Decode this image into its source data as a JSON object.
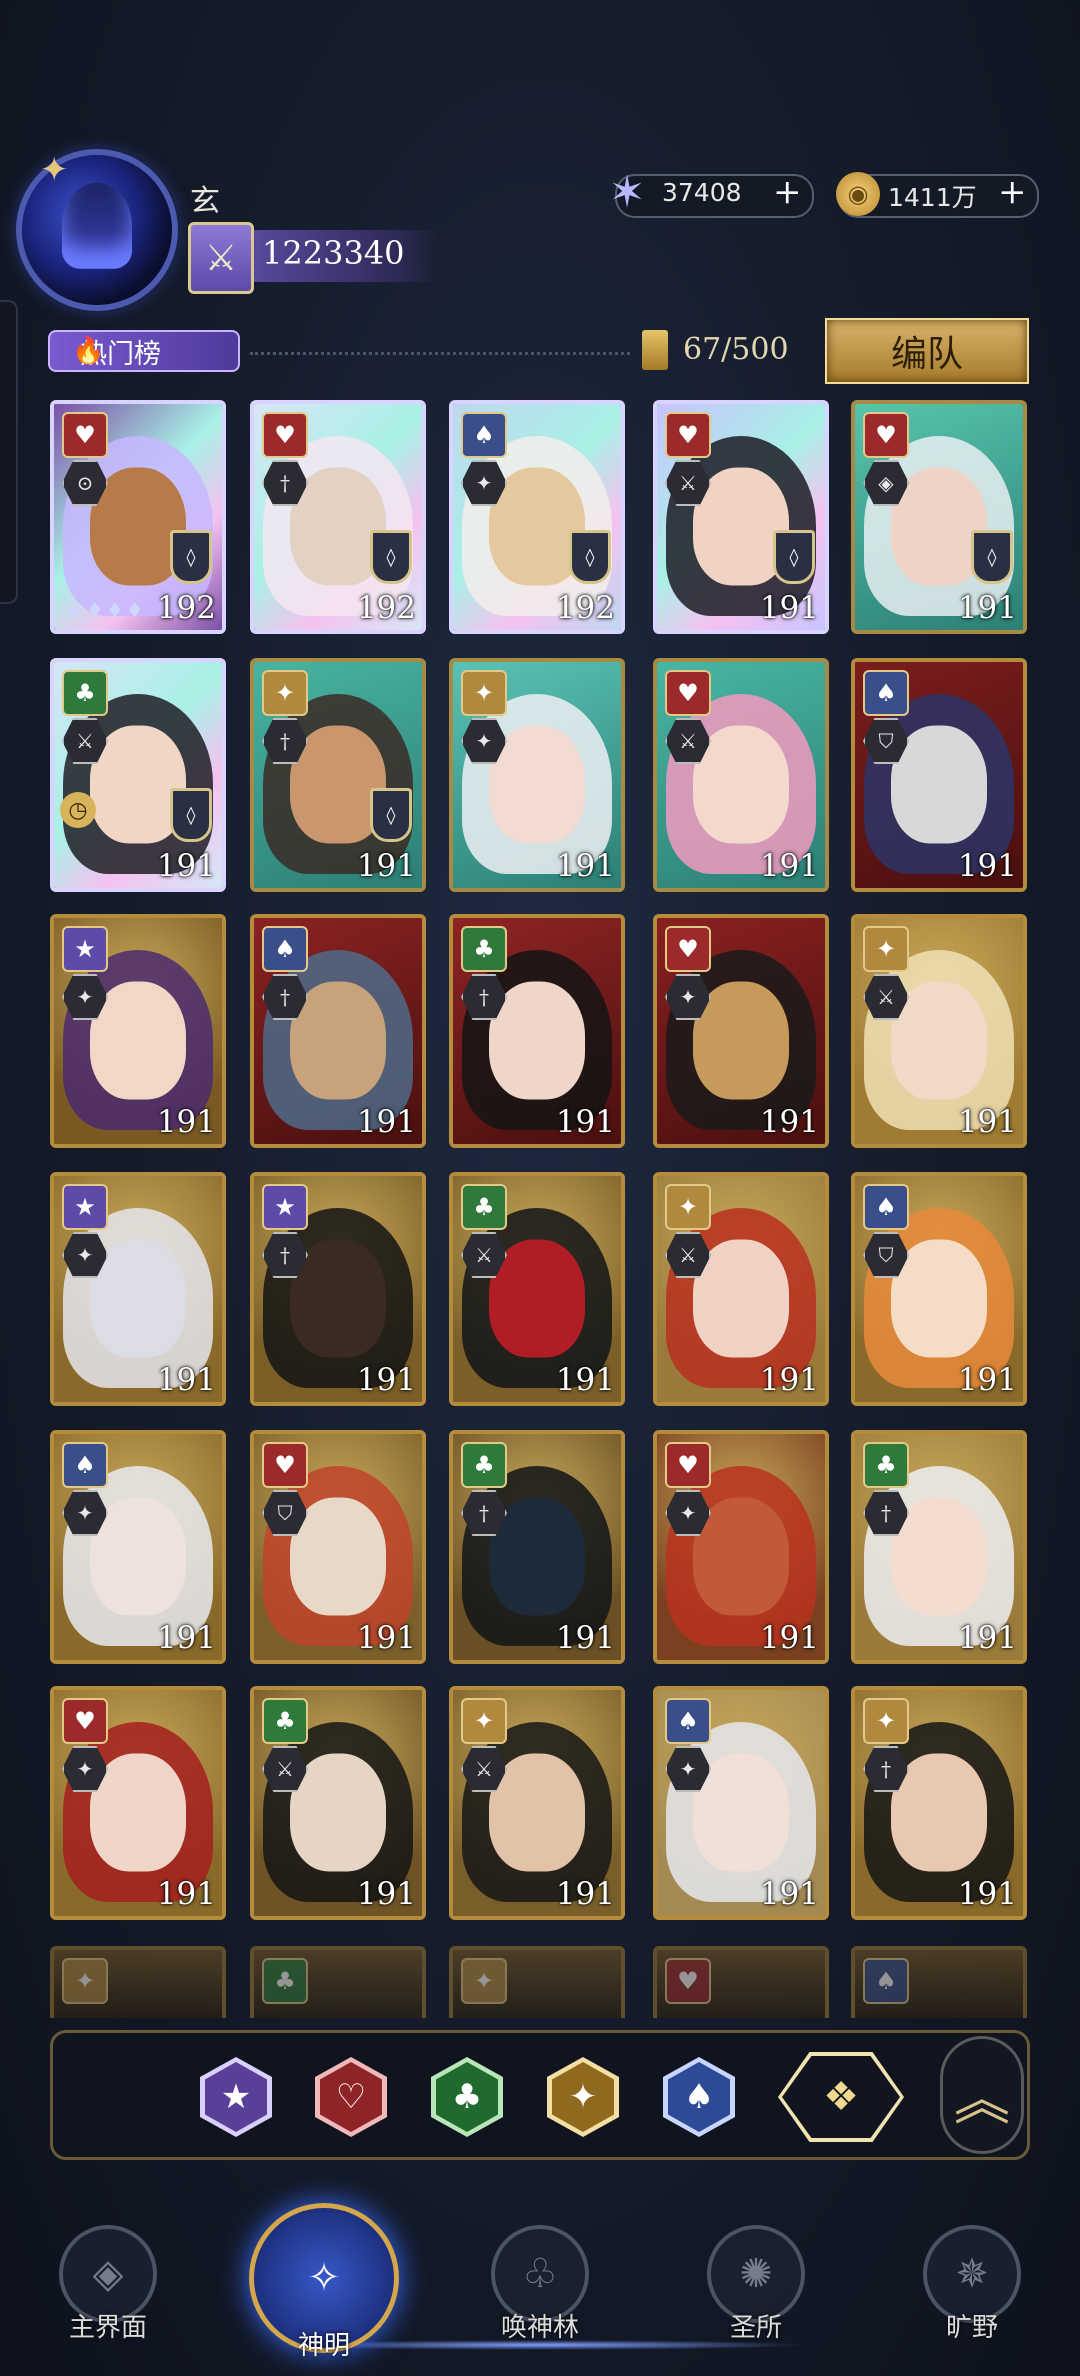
{
  "header": {
    "player_name": "玄",
    "power": "1223340",
    "rank_icon": "crossed-swords-icon"
  },
  "currency": {
    "gems": "37408",
    "gold": "1411万",
    "add_symbol": "+"
  },
  "toolbar": {
    "hot_tab_label": "热门榜",
    "card_count": "67/500",
    "team_button": "编队"
  },
  "grid": {
    "rows": [
      [
        {
          "suit": "heart",
          "suit_symbol": "♥",
          "cls": "⊙",
          "level": "192",
          "frame": "holo",
          "extra": "shield+diamonds",
          "colors": [
            "#7a4fa6",
            "#c8b7ff",
            "#b87a48"
          ]
        },
        {
          "suit": "heart",
          "suit_symbol": "♥",
          "cls": "†",
          "level": "192",
          "frame": "holo",
          "extra": "shield",
          "colors": [
            "#d8e6f5",
            "#f5e6f2",
            "#e3d2c4"
          ]
        },
        {
          "suit": "spade",
          "suit_symbol": "♠",
          "cls": "✦",
          "level": "192",
          "frame": "holo",
          "extra": "shield",
          "colors": [
            "#bfd8f0",
            "#f3eeea",
            "#e6c89e"
          ]
        },
        {
          "suit": "heart",
          "suit_symbol": "♥",
          "cls": "⚔",
          "level": "191",
          "frame": "holo",
          "extra": "shield",
          "colors": [
            "#c8c4ff",
            "#1b1b24",
            "#f0d3c3"
          ]
        },
        {
          "suit": "heart",
          "suit_symbol": "♥",
          "cls": "◈",
          "level": "191",
          "frame": "teal",
          "extra": "shield",
          "colors": [
            "#57c4ad",
            "#e9eef2",
            "#efd3c7"
          ]
        }
      ],
      [
        {
          "suit": "club",
          "suit_symbol": "♣",
          "cls": "⚔",
          "level": "191",
          "frame": "holo",
          "extra": "shield+clock",
          "colors": [
            "#d5e6f6",
            "#1d1d24",
            "#f1d6c6"
          ]
        },
        {
          "suit": "diamond",
          "suit_symbol": "✦",
          "cls": "†",
          "level": "191",
          "frame": "teal",
          "extra": "shield",
          "colors": [
            "#49b3a1",
            "#3a2a24",
            "#c9966e"
          ]
        },
        {
          "suit": "diamond",
          "suit_symbol": "✦",
          "cls": "✦",
          "level": "191",
          "frame": "teal",
          "extra": "",
          "colors": [
            "#5ac2b4",
            "#eef0f4",
            "#f1dbd3"
          ]
        },
        {
          "suit": "heart",
          "suit_symbol": "♥",
          "cls": "⚔",
          "level": "191",
          "frame": "teal",
          "extra": "",
          "colors": [
            "#49b6a4",
            "#f29ac1",
            "#f3d8cc"
          ]
        },
        {
          "suit": "spade",
          "suit_symbol": "♠",
          "cls": "⛉",
          "level": "191",
          "frame": "red",
          "extra": "",
          "colors": [
            "#7b1d1d",
            "#2c3567",
            "#d8d8d8"
          ]
        }
      ],
      [
        {
          "suit": "star",
          "suit_symbol": "★",
          "cls": "✦",
          "level": "191",
          "frame": "gold",
          "extra": "",
          "colors": [
            "#7a5a22",
            "#4a2a6e",
            "#f2d6c6"
          ]
        },
        {
          "suit": "spade",
          "suit_symbol": "♠",
          "cls": "†",
          "level": "191",
          "frame": "red",
          "extra": "",
          "colors": [
            "#8a2222",
            "#4e6b88",
            "#c7a27a"
          ]
        },
        {
          "suit": "club",
          "suit_symbol": "♣",
          "cls": "†",
          "level": "191",
          "frame": "red",
          "extra": "",
          "colors": [
            "#8f2424",
            "#141414",
            "#f0d6c8"
          ]
        },
        {
          "suit": "heart",
          "suit_symbol": "♥",
          "cls": "✦",
          "level": "191",
          "frame": "red",
          "extra": "",
          "colors": [
            "#8a2020",
            "#1a1a1a",
            "#c59a5a"
          ]
        },
        {
          "suit": "diamond",
          "suit_symbol": "✦",
          "cls": "⚔",
          "level": "191",
          "frame": "gold",
          "extra": "",
          "colors": [
            "#a07b32",
            "#f0e0b6",
            "#f1d9c7"
          ]
        }
      ],
      [
        {
          "suit": "star",
          "suit_symbol": "★",
          "cls": "✦",
          "level": "191",
          "frame": "gold",
          "extra": "",
          "colors": [
            "#8a6a2a",
            "#e5e5ec",
            "#dcdce4"
          ]
        },
        {
          "suit": "star",
          "suit_symbol": "★",
          "cls": "†",
          "level": "191",
          "frame": "gold",
          "extra": "",
          "colors": [
            "#7a5e26",
            "#141414",
            "#3a2a22"
          ]
        },
        {
          "suit": "club",
          "suit_symbol": "♣",
          "cls": "⚔",
          "level": "191",
          "frame": "gold",
          "extra": "",
          "colors": [
            "#7c5f28",
            "#101418",
            "#b01d24"
          ]
        },
        {
          "suit": "diamond",
          "suit_symbol": "✦",
          "cls": "⚔",
          "level": "191",
          "frame": "gold",
          "extra": "",
          "colors": [
            "#9a7b3a",
            "#b83020",
            "#f0d3c4"
          ]
        },
        {
          "suit": "spade",
          "suit_symbol": "♠",
          "cls": "⛉",
          "level": "191",
          "frame": "gold",
          "extra": "",
          "colors": [
            "#8a6a2a",
            "#e88a3a",
            "#f4dcc6"
          ]
        }
      ],
      [
        {
          "suit": "spade",
          "suit_symbol": "♠",
          "cls": "✦",
          "level": "191",
          "frame": "gold",
          "extra": "",
          "colors": [
            "#8a6a2a",
            "#e9eaf0",
            "#ede2dc"
          ]
        },
        {
          "suit": "heart",
          "suit_symbol": "♥",
          "cls": "⛉",
          "level": "191",
          "frame": "gold",
          "extra": "",
          "colors": [
            "#7c5f2a",
            "#c0432a",
            "#e8d8c8"
          ]
        },
        {
          "suit": "club",
          "suit_symbol": "♣",
          "cls": "†",
          "level": "191",
          "frame": "gold",
          "extra": "",
          "colors": [
            "#6a5024",
            "#101418",
            "#1c2a3a"
          ]
        },
        {
          "suit": "heart",
          "suit_symbol": "♥",
          "cls": "✦",
          "level": "191",
          "frame": "gold",
          "extra": "",
          "colors": [
            "#7a4020",
            "#b8321e",
            "#c25a3a"
          ]
        },
        {
          "suit": "club",
          "suit_symbol": "♣",
          "cls": "†",
          "level": "191",
          "frame": "gold",
          "extra": "",
          "colors": [
            "#9a7b3a",
            "#eef0f3",
            "#f2ddd0"
          ]
        }
      ],
      [
        {
          "suit": "heart",
          "suit_symbol": "♥",
          "cls": "✦",
          "level": "191",
          "frame": "gold",
          "extra": "",
          "colors": [
            "#8a6a2a",
            "#a41f1f",
            "#f0d6c8"
          ]
        },
        {
          "suit": "club",
          "suit_symbol": "♣",
          "cls": "⚔",
          "level": "191",
          "frame": "gold",
          "extra": "",
          "colors": [
            "#6f5426",
            "#151515",
            "#e6d4c4"
          ]
        },
        {
          "suit": "diamond",
          "suit_symbol": "✦",
          "cls": "⚔",
          "level": "191",
          "frame": "gold",
          "extra": "",
          "colors": [
            "#7a5e2a",
            "#161616",
            "#e3c3a8"
          ]
        },
        {
          "suit": "spade",
          "suit_symbol": "♠",
          "cls": "✦",
          "level": "191",
          "frame": "gold",
          "extra": "",
          "colors": [
            "#a48a52",
            "#e6e8ee",
            "#f0e0d8"
          ]
        },
        {
          "suit": "diamond",
          "suit_symbol": "✦",
          "cls": "†",
          "level": "191",
          "frame": "gold",
          "extra": "",
          "colors": [
            "#8a6a2a",
            "#151515",
            "#e8c8b0"
          ]
        }
      ]
    ],
    "partial_row": [
      {
        "suit_symbol": "✦",
        "color": "#b0893e"
      },
      {
        "suit_symbol": "♣",
        "color": "#2f7a3a"
      },
      {
        "suit_symbol": "✦",
        "color": "#b0893e"
      },
      {
        "suit_symbol": "♥",
        "color": "#9c2a2a"
      },
      {
        "suit_symbol": "♠",
        "color": "#3a4f8a"
      }
    ]
  },
  "filters": [
    {
      "name": "star",
      "symbol": "★",
      "outer": "#d8d0ff",
      "inner": "#5a3f98"
    },
    {
      "name": "heart",
      "symbol": "♡",
      "outer": "#f0b8b8",
      "inner": "#8e2328"
    },
    {
      "name": "club",
      "symbol": "♣",
      "outer": "#b8e6b8",
      "inner": "#1f6a2c"
    },
    {
      "name": "diamond",
      "symbol": "✦",
      "outer": "#f3dfa4",
      "inner": "#8f6a1e"
    },
    {
      "name": "spade",
      "symbol": "♠",
      "outer": "#c8d6ff",
      "inner": "#2c4a96"
    }
  ],
  "filter_all_symbol": "❖",
  "collapse_symbol": "︽",
  "nav": [
    {
      "label": "主界面",
      "icon": "main-interface-icon",
      "symbol": "◈",
      "active": false
    },
    {
      "label": "神明",
      "icon": "god-card-icon",
      "symbol": "✧",
      "active": true
    },
    {
      "label": "唤神林",
      "icon": "summon-tree-icon",
      "symbol": "♧",
      "active": false
    },
    {
      "label": "圣所",
      "icon": "sanctuary-icon",
      "symbol": "✺",
      "active": false
    },
    {
      "label": "旷野",
      "icon": "compass-icon",
      "symbol": "✵",
      "active": false
    }
  ],
  "suit_colors": {
    "heart": "#9c2a2a",
    "spade": "#3a4f8a",
    "club": "#2f7a3a",
    "diamond": "#b0893e",
    "star": "#5f4aa8"
  }
}
